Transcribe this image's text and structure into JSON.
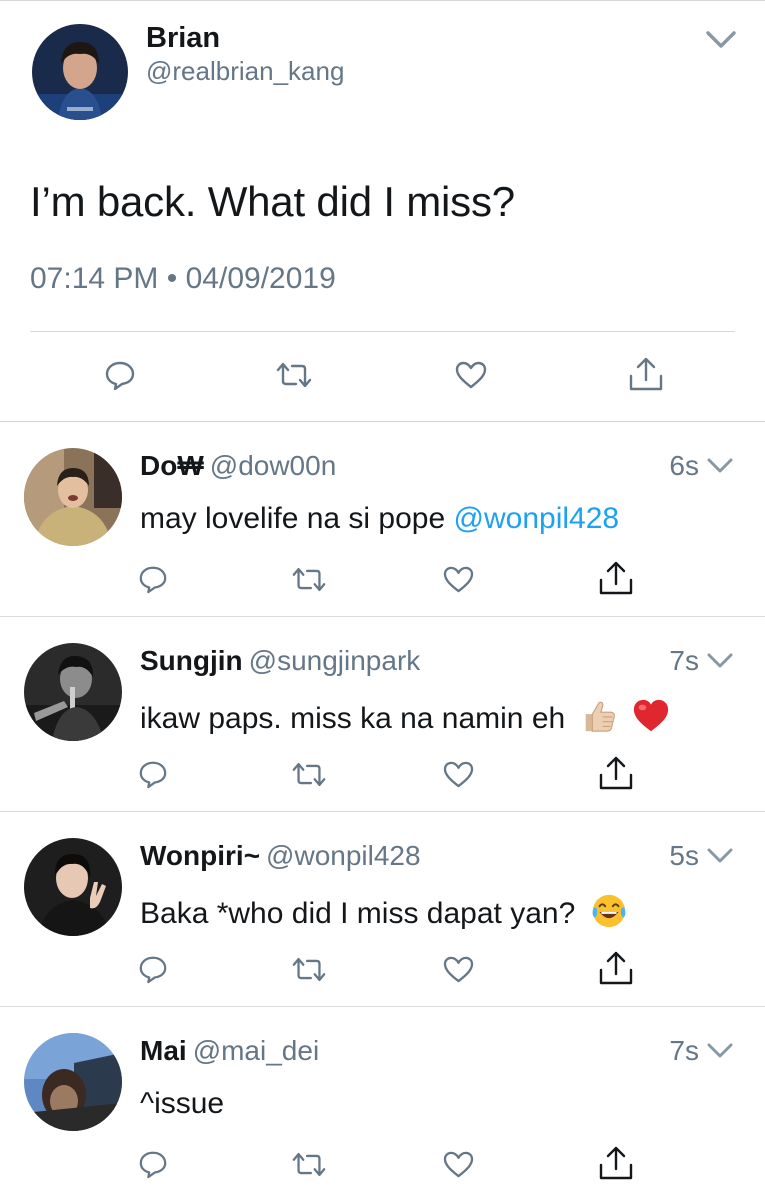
{
  "main_tweet": {
    "name": "Brian",
    "handle": "@realbrian_kang",
    "text": "I’m back. What did I miss?",
    "time": "07:14 PM",
    "separator": "•",
    "date": "04/09/2019"
  },
  "replies": [
    {
      "name": "Do₩",
      "handle": "@dow00n",
      "time": "6s",
      "text": "may lovelife na si pope",
      "mention": "@wonpil428",
      "emoji": []
    },
    {
      "name": "Sungjin",
      "handle": "@sungjinpark",
      "time": "7s",
      "text": "ikaw paps. miss ka na namin eh",
      "mention": "",
      "emoji": [
        "thumbs-up",
        "red-heart"
      ]
    },
    {
      "name": "Wonpiri~",
      "handle": "@wonpil428",
      "time": "5s",
      "text": "Baka *who did I miss dapat yan?",
      "mention": "",
      "emoji": [
        "tears-of-joy"
      ]
    },
    {
      "name": "Mai",
      "handle": "@mai_dei",
      "time": "7s",
      "text": "^issue",
      "mention": "",
      "emoji": []
    }
  ],
  "icons": [
    "chevron-down-icon",
    "reply-icon",
    "retweet-icon",
    "like-icon",
    "share-icon"
  ],
  "colors": {
    "link": "#1da1f2",
    "secondary_text": "#657786",
    "icon": "#657786",
    "primary_text": "#14171a",
    "divider": "#d6d9dc"
  }
}
